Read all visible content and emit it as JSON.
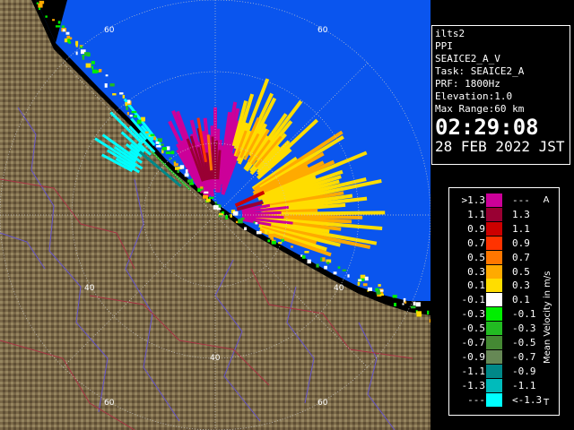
{
  "info": {
    "lines": [
      "ilts2",
      "PPI",
      "SEAICE2_A_V",
      "Task: SEAICE2_A",
      "PRF: 1800Hz",
      "Elevation:1.0",
      "Max Range:60 km"
    ],
    "time": "02:29:08",
    "date": "28 FEB 2022 JST"
  },
  "legend": {
    "unit": "Mean Velocity in m/s",
    "tag_top": "A",
    "tag_bottom": "T",
    "rows": [
      {
        "left": ">1.3",
        "right": "---",
        "color": "#cc0099"
      },
      {
        "left": "1.1",
        "right": "1.3",
        "color": "#990033"
      },
      {
        "left": "0.9",
        "right": "1.1",
        "color": "#cc0000"
      },
      {
        "left": "0.7",
        "right": "0.9",
        "color": "#ff3300"
      },
      {
        "left": "0.5",
        "right": "0.7",
        "color": "#ff7700"
      },
      {
        "left": "0.3",
        "right": "0.5",
        "color": "#ffaa00"
      },
      {
        "left": "0.1",
        "right": "0.3",
        "color": "#ffdd00"
      },
      {
        "left": "-0.1",
        "right": "0.1",
        "color": "#ffffff"
      },
      {
        "left": "-0.3",
        "right": "-0.1",
        "color": "#00ee00"
      },
      {
        "left": "-0.5",
        "right": "-0.3",
        "color": "#22bb22"
      },
      {
        "left": "-0.7",
        "right": "-0.5",
        "color": "#448833"
      },
      {
        "left": "-0.9",
        "right": "-0.7",
        "color": "#668855"
      },
      {
        "left": "-1.1",
        "right": "-0.9",
        "color": "#008888"
      },
      {
        "left": "-1.3",
        "right": "-1.1",
        "color": "#00bbbb"
      },
      {
        "left": "---",
        "right": "<-1.3",
        "color": "#00ffff"
      }
    ]
  },
  "map": {
    "range_labels": [
      "60",
      "60",
      "40",
      "40",
      "40",
      "60",
      "60"
    ],
    "colors": {
      "sea": "#0a55ee",
      "land": "#7a6848",
      "grid": "#c8c8c8",
      "river": "#6655cc",
      "border": "#aa3344"
    }
  }
}
